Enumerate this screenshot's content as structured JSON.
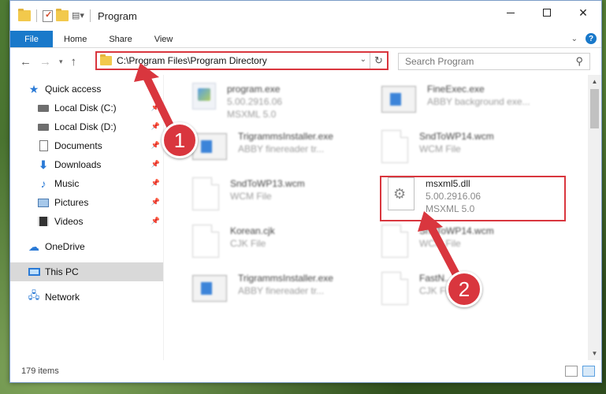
{
  "window": {
    "title": "Program",
    "quick_access_toolbar": [
      "folder-icon",
      "properties-icon",
      "new-folder-icon",
      "customize-icon"
    ]
  },
  "ribbon": {
    "tabs": [
      {
        "label": "File"
      },
      {
        "label": "Home"
      },
      {
        "label": "Share"
      },
      {
        "label": "View"
      }
    ],
    "help_label": "?"
  },
  "navbar": {
    "address_path": "C:\\Program Files\\Program Directory",
    "search_placeholder": "Search Program"
  },
  "sidebar": {
    "items": [
      {
        "label": "Quick access",
        "icon": "star-icon",
        "pinned": false
      },
      {
        "label": "Local Disk (C:)",
        "icon": "drive-icon",
        "pinned": true
      },
      {
        "label": "Local Disk (D:)",
        "icon": "drive-icon",
        "pinned": true
      },
      {
        "label": "Documents",
        "icon": "documents-icon",
        "pinned": true
      },
      {
        "label": "Downloads",
        "icon": "download-icon",
        "pinned": true
      },
      {
        "label": "Music",
        "icon": "music-icon",
        "pinned": true
      },
      {
        "label": "Pictures",
        "icon": "pictures-icon",
        "pinned": true
      },
      {
        "label": "Videos",
        "icon": "videos-icon",
        "pinned": true
      },
      {
        "label": "OneDrive",
        "icon": "cloud-icon",
        "pinned": false
      },
      {
        "label": "This PC",
        "icon": "computer-icon",
        "pinned": false,
        "selected": true
      },
      {
        "label": "Network",
        "icon": "network-icon",
        "pinned": false
      }
    ]
  },
  "files": [
    {
      "name": "program.exe",
      "line2": "5.00.2916.06",
      "line3": "MSXML 5.0",
      "icon": "exe-icon",
      "blurred": true
    },
    {
      "name": "FineExec.exe",
      "line2": "ABBY background exe...",
      "line3": "",
      "icon": "app-icon",
      "blurred": true
    },
    {
      "name": "TrigrammsInstaller.exe",
      "line2": "ABBY finereader tr...",
      "line3": "",
      "icon": "app-icon",
      "blurred": true
    },
    {
      "name": "SndToWP14.wcm",
      "line2": "WCM File",
      "line3": "",
      "icon": "file-icon",
      "blurred": true
    },
    {
      "name": "SndToWP13.wcm",
      "line2": "WCM File",
      "line3": "",
      "icon": "file-icon",
      "blurred": true
    },
    {
      "name": "msxml5.dll",
      "line2": "5.00.2916.06",
      "line3": "MSXML 5.0",
      "icon": "dll-gear-icon",
      "blurred": false,
      "highlighted": true
    },
    {
      "name": "Korean.cjk",
      "line2": "CJK File",
      "line3": "",
      "icon": "file-icon",
      "blurred": true
    },
    {
      "name": "SndToWP14.wcm",
      "line2": "WCM File",
      "line3": "",
      "icon": "file-icon",
      "blurred": true
    },
    {
      "name": "TrigrammsInstaller.exe",
      "line2": "ABBY finereader tr...",
      "line3": "",
      "icon": "app-icon",
      "blurred": true
    },
    {
      "name": "FastN....",
      "line2": "CJK File",
      "line3": "",
      "icon": "file-icon",
      "blurred": true
    }
  ],
  "statusbar": {
    "item_count": "179 items"
  },
  "callouts": [
    {
      "number": "1"
    },
    {
      "number": "2"
    }
  ],
  "colors": {
    "highlight_red": "#d9363e",
    "file_tab_blue": "#1979ca",
    "selected_gray": "#d9d9d9"
  }
}
